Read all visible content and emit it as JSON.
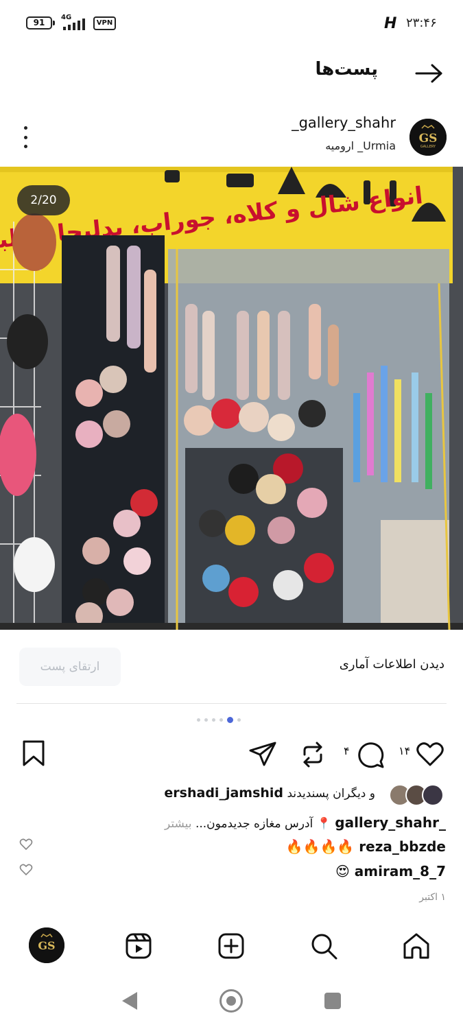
{
  "status_bar": {
    "battery": "91",
    "network": "4G",
    "vpn": "VPN",
    "time": "۲۳:۴۶"
  },
  "header": {
    "title": "پست‌ها"
  },
  "post": {
    "username": "_gallery_shahr",
    "location": "ارومیه _Urmia",
    "media_counter": "2/20",
    "sign_text": "انواع شال و کلاه، جوراب، بدلیجات، لباس زیر",
    "stats_link": "دیدن اطلاعات آماری",
    "boost_button": "ارتقای پست",
    "carousel": {
      "count": 6,
      "active": 5
    },
    "likes_count": "۱۴",
    "comments_count": "۴",
    "liked_by_user": "ershadi_jamshid",
    "liked_by_suffix": "و دیگران پسندیدند",
    "caption_user": "_gallery_shahr",
    "caption_text": "📍 آدرس مغازه جدیدمون...",
    "caption_more": "بیشتر",
    "comments": [
      {
        "user": "reza_bbzde",
        "text": "🔥🔥🔥🔥"
      },
      {
        "user": "amiram_8_7",
        "text": "😍"
      }
    ],
    "date": "۱ اکتبر"
  },
  "bottom_nav": {
    "items": [
      "home-icon",
      "search-icon",
      "add-post-icon",
      "reels-icon",
      "profile-avatar"
    ]
  },
  "colors": {
    "accent_dot": "#4c67d8",
    "sign_yellow": "#f3d52b",
    "sign_red": "#c8102e"
  }
}
